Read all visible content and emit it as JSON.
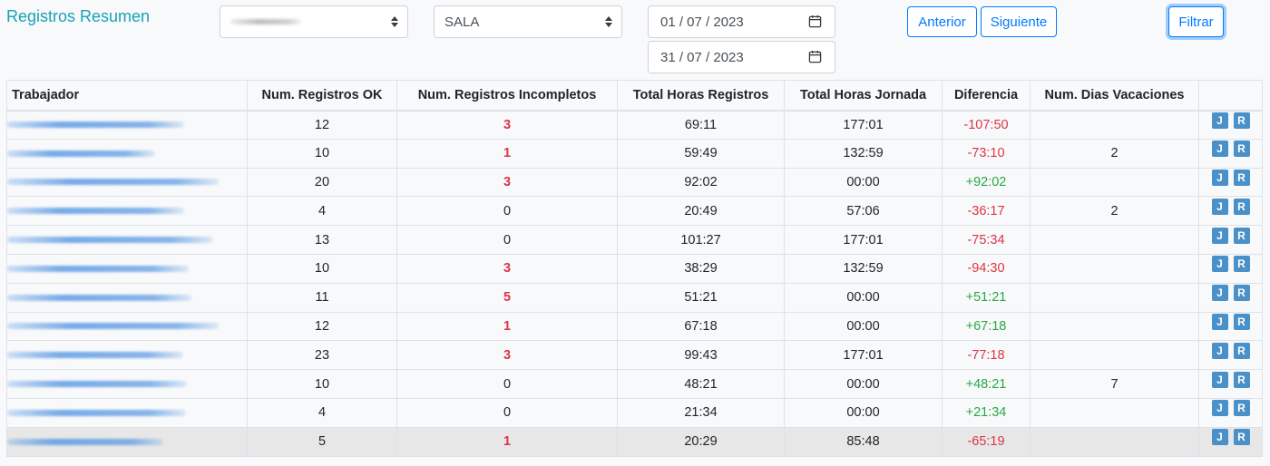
{
  "page": {
    "title": "Registros Resumen"
  },
  "filters": {
    "select_1_value": "",
    "select_2_value": "SALA",
    "date_from": "01 / 07 / 2023",
    "date_to": "31 / 07 / 2023",
    "prev_label": "Anterior",
    "next_label": "Siguiente",
    "filter_label": "Filtrar"
  },
  "table": {
    "headers": [
      "Trabajador",
      "Num. Registros OK",
      "Num. Registros Incompletos",
      "Total Horas Registros",
      "Total Horas Jornada",
      "Diferencia",
      "Num. Dias Vacaciones",
      ""
    ],
    "action_j": "J",
    "action_r": "R",
    "rows": [
      {
        "ok": "12",
        "inc": "3",
        "reg": "69:11",
        "jor": "177:01",
        "dif": "-107:50",
        "vac": ""
      },
      {
        "ok": "10",
        "inc": "1",
        "reg": "59:49",
        "jor": "132:59",
        "dif": "-73:10",
        "vac": "2"
      },
      {
        "ok": "20",
        "inc": "3",
        "reg": "92:02",
        "jor": "00:00",
        "dif": "+92:02",
        "vac": ""
      },
      {
        "ok": "4",
        "inc": "0",
        "reg": "20:49",
        "jor": "57:06",
        "dif": "-36:17",
        "vac": "2"
      },
      {
        "ok": "13",
        "inc": "0",
        "reg": "101:27",
        "jor": "177:01",
        "dif": "-75:34",
        "vac": ""
      },
      {
        "ok": "10",
        "inc": "3",
        "reg": "38:29",
        "jor": "132:59",
        "dif": "-94:30",
        "vac": ""
      },
      {
        "ok": "11",
        "inc": "5",
        "reg": "51:21",
        "jor": "00:00",
        "dif": "+51:21",
        "vac": ""
      },
      {
        "ok": "12",
        "inc": "1",
        "reg": "67:18",
        "jor": "00:00",
        "dif": "+67:18",
        "vac": ""
      },
      {
        "ok": "23",
        "inc": "3",
        "reg": "99:43",
        "jor": "177:01",
        "dif": "-77:18",
        "vac": ""
      },
      {
        "ok": "10",
        "inc": "0",
        "reg": "48:21",
        "jor": "00:00",
        "dif": "+48:21",
        "vac": "7"
      },
      {
        "ok": "4",
        "inc": "0",
        "reg": "21:34",
        "jor": "00:00",
        "dif": "+21:34",
        "vac": ""
      },
      {
        "ok": "5",
        "inc": "1",
        "reg": "20:29",
        "jor": "85:48",
        "dif": "-65:19",
        "vac": ""
      }
    ]
  },
  "colors": {
    "title": "#17a2b8",
    "primary": "#007bff",
    "danger": "#dc3545",
    "success": "#28a745",
    "action_button": "#4a90c9"
  }
}
